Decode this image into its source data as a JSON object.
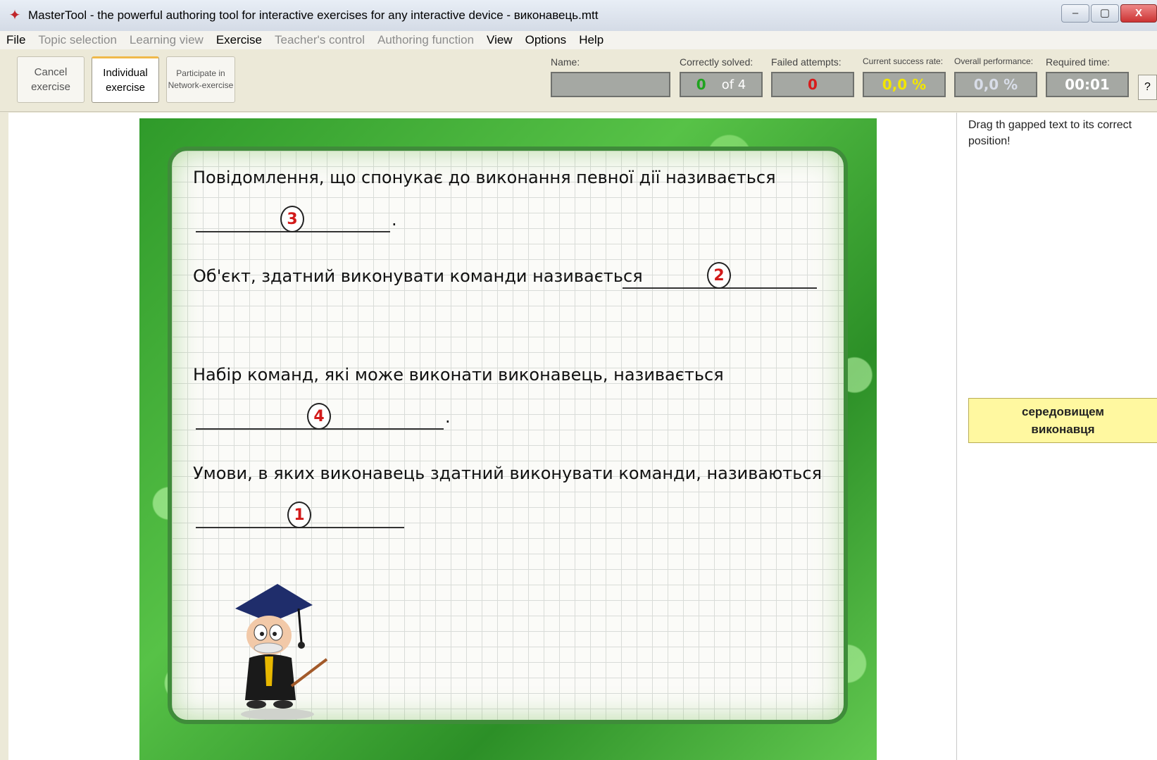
{
  "window": {
    "title": "MasterTool - the powerful authoring tool for interactive exercises for any interactive device - виконавець.mtt",
    "minimize": "–",
    "maximize": "▢",
    "close": "X"
  },
  "menu": [
    {
      "label": "File",
      "enabled": true
    },
    {
      "label": "Topic selection",
      "enabled": false
    },
    {
      "label": "Learning view",
      "enabled": false
    },
    {
      "label": "Exercise",
      "enabled": true
    },
    {
      "label": "Teacher's control",
      "enabled": false
    },
    {
      "label": "Authoring function",
      "enabled": false
    },
    {
      "label": "View",
      "enabled": true
    },
    {
      "label": "Options",
      "enabled": true
    },
    {
      "label": "Help",
      "enabled": true
    }
  ],
  "toolbar": {
    "cancel": "Cancel\nexercise",
    "individual": "Individual\nexercise",
    "network": "Participate in\nNetwork-exercise",
    "help": "?"
  },
  "stats": {
    "name_label": "Name:",
    "name_value": "",
    "solved_label": "Correctly solved:",
    "solved_value": "0",
    "solved_total": "of 4",
    "failed_label": "Failed attempts:",
    "failed_value": "0",
    "current_label": "Current success rate:",
    "current_value": "0,0 %",
    "overall_label": "Overall performance:",
    "overall_value": "0,0 %",
    "time_label": "Required time:",
    "time_value": "00:01"
  },
  "exercise": {
    "q1": "Повідомлення, що спонукає до виконання певної дії називається",
    "q1_marker": "3",
    "q2": "Об'єкт, здатний виконувати команди називається",
    "q2_marker": "2",
    "q3": "Набір команд, які може виконати виконавець, називається",
    "q3_marker": "4",
    "q4": "Умови, в яких виконавець здатний виконувати команди, називаються",
    "q4_marker": "1",
    "dot": "."
  },
  "side": {
    "instructions": "Drag th gapped text to its correct position!",
    "card": "середовищем\nвиконавця"
  },
  "colors": {
    "solved": "#1fa31f",
    "failed": "#d81b1b",
    "rate": "#f2e600",
    "overall": "#d8dde8",
    "time": "#ffffff",
    "marker": "#d21a1a"
  }
}
